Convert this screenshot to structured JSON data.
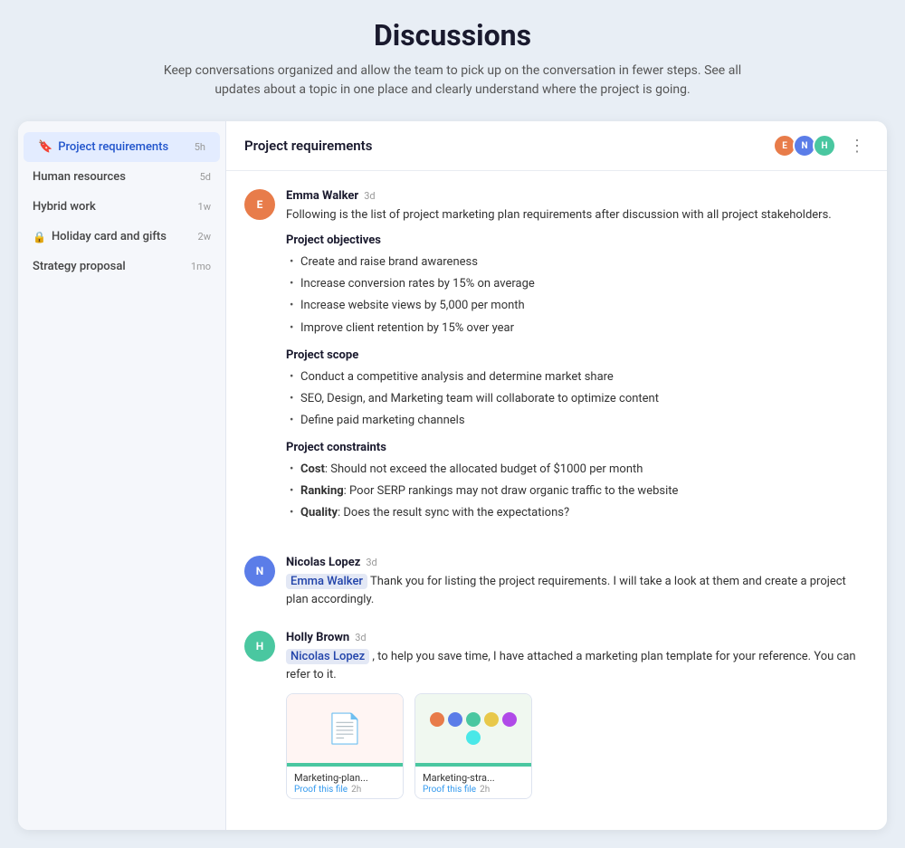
{
  "page": {
    "title": "Discussions",
    "subtitle": "Keep conversations organized and allow the team to pick up on the conversation in fewer steps. See all updates about a topic in one place and clearly understand where the project is going."
  },
  "sidebar": {
    "items": [
      {
        "id": "project-requirements",
        "label": "Project requirements",
        "time": "5h",
        "active": true,
        "icon": "bookmark",
        "locked": false
      },
      {
        "id": "human-resources",
        "label": "Human resources",
        "time": "5d",
        "active": false,
        "icon": "",
        "locked": false
      },
      {
        "id": "hybrid-work",
        "label": "Hybrid work",
        "time": "1w",
        "active": false,
        "icon": "",
        "locked": false
      },
      {
        "id": "holiday-card-gifts",
        "label": "Holiday card and gifts",
        "time": "2w",
        "active": false,
        "icon": "",
        "locked": true
      },
      {
        "id": "strategy-proposal",
        "label": "Strategy proposal",
        "time": "1mo",
        "active": false,
        "icon": "",
        "locked": false
      }
    ]
  },
  "thread": {
    "title": "Project requirements",
    "more_button": "⋮",
    "avatars": [
      {
        "initials": "E",
        "color": "#e87c4a"
      },
      {
        "initials": "N",
        "color": "#5b7de8"
      },
      {
        "initials": "H",
        "color": "#4ac7a0"
      }
    ]
  },
  "messages": [
    {
      "id": "msg1",
      "author": "Emma Walker",
      "time": "3d",
      "avatar_initials": "E",
      "avatar_color": "#e87c4a",
      "intro": "Following is the list of project marketing plan requirements after discussion with all project stakeholders.",
      "sections": [
        {
          "title": "Project objectives",
          "bullets": [
            "Create and raise brand awareness",
            "Increase conversion rates by 15% on average",
            "Increase website views by 5,000 per month",
            "Improve client retention by 15% over year"
          ]
        },
        {
          "title": "Project scope",
          "bullets": [
            "Conduct a competitive analysis and determine market share",
            "SEO, Design, and Marketing team will collaborate to optimize content",
            "Define paid marketing channels"
          ]
        },
        {
          "title": "Project constraints",
          "bullets": [
            {
              "key": "Cost",
              "text": ": Should not exceed the allocated budget of $1000 per month"
            },
            {
              "key": "Ranking",
              "text": ": Poor SERP rankings may not draw organic traffic to the website"
            },
            {
              "key": "Quality",
              "text": ": Does the result sync with the expectations?"
            }
          ]
        }
      ]
    },
    {
      "id": "msg2",
      "author": "Nicolas Lopez",
      "time": "3d",
      "avatar_initials": "N",
      "avatar_color": "#5b7de8",
      "mention": "Emma Walker",
      "text": " Thank you for listing the project requirements. I will take a look at them and create a project plan accordingly."
    },
    {
      "id": "msg3",
      "author": "Holly Brown",
      "time": "3d",
      "avatar_initials": "H",
      "avatar_color": "#4ac7a0",
      "mention": "Nicolas Lopez",
      "text": " , to help you save time, I have attached a marketing plan template for your reference. You can refer to it.",
      "attachments": [
        {
          "id": "att1",
          "name": "Marketing-plan...",
          "proof_text": "Proof this file",
          "proof_time": "2h",
          "type": "pdf"
        },
        {
          "id": "att2",
          "name": "Marketing-stra...",
          "proof_text": "Proof this file",
          "proof_time": "2h",
          "type": "img"
        }
      ]
    }
  ]
}
